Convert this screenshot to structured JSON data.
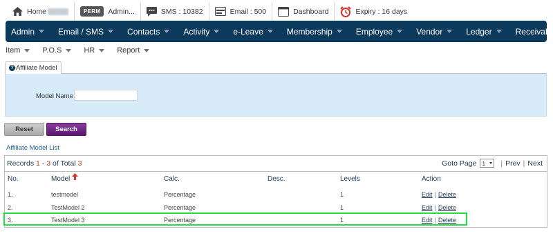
{
  "topbar": {
    "home_label": "Home",
    "perm_badge": "PERM",
    "admin_label": "Admin...",
    "sms_label": "SMS : 10382",
    "email_label": "Email : 500",
    "dashboard_label": "Dashboard",
    "expiry_label": "Expiry : 16 days"
  },
  "mainnav": [
    "Admin",
    "Email / SMS",
    "Contacts",
    "Activity",
    "e-Leave",
    "Membership",
    "Employee",
    "Vendor",
    "Ledger",
    "Receivables"
  ],
  "subnav": [
    "Item",
    "P.O.S",
    "HR",
    "Report"
  ],
  "tab": {
    "label": "Affiliate Model",
    "icon": "help-icon"
  },
  "filter": {
    "model_name_label": "Model Name",
    "model_name_value": "",
    "model_name_placeholder": ""
  },
  "buttons": {
    "reset": "Reset",
    "search": "Search"
  },
  "list_title": "Affiliate Model List",
  "records": {
    "prefix": "Records",
    "from": "1",
    "dash": "-",
    "to": "3",
    "of_total": "of Total",
    "total": "3"
  },
  "pager": {
    "goto_label": "Goto Page",
    "page_value": "1",
    "prev": "Prev",
    "next": "Next",
    "sep": "|"
  },
  "columns": [
    "No.",
    "Model",
    "Calc.",
    "Desc.",
    "Levels",
    "Action"
  ],
  "rows": [
    {
      "no": "1.",
      "model": "testmodel",
      "calc": "Percentage",
      "desc": "",
      "levels": "1",
      "edit": "Edit",
      "delete": "Delete"
    },
    {
      "no": "2.",
      "model": "TestModel 2",
      "calc": "Percentage",
      "desc": "",
      "levels": "1",
      "edit": "Edit",
      "delete": "Delete"
    },
    {
      "no": "3.",
      "model": "TestModel 3",
      "calc": "Percentage",
      "desc": "",
      "levels": "1",
      "edit": "Edit",
      "delete": "Delete"
    }
  ],
  "colors": {
    "nav_bg": "#0b3a5c",
    "panel_bg": "#d7ecf8",
    "search_btn": "#6a1f80",
    "highlight": "#22e043",
    "red": "#c0392b"
  }
}
